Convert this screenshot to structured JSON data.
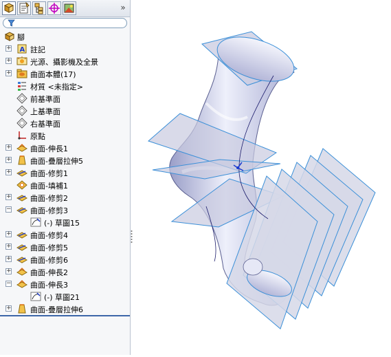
{
  "tabs": [
    {
      "name": "featuremanager-tab",
      "icon": "featuremanager-tree-icon"
    },
    {
      "name": "propertymanager-tab",
      "icon": "property-manager-icon"
    },
    {
      "name": "configurationmanager-tab",
      "icon": "configuration-manager-icon"
    },
    {
      "name": "dimxpert-tab",
      "icon": "dimxpert-crosshair-icon"
    },
    {
      "name": "display-manager-tab",
      "icon": "display-manager-icon"
    }
  ],
  "more_glyph": "»",
  "tree": {
    "root": {
      "label": "腳",
      "icon": "part-icon"
    },
    "items": [
      {
        "label": "註記",
        "icon": "annotations-icon",
        "expander": "+"
      },
      {
        "label": "光源、攝影機及全景",
        "icon": "lights-cameras-icon",
        "expander": "+"
      },
      {
        "label": "曲面本體(17)",
        "icon": "surface-bodies-folder-icon",
        "expander": "+"
      },
      {
        "label": "材質 <未指定>",
        "icon": "material-icon",
        "expander": ""
      },
      {
        "label": "前基準面",
        "icon": "plane-icon",
        "expander": ""
      },
      {
        "label": "上基準面",
        "icon": "plane-icon",
        "expander": ""
      },
      {
        "label": "右基準面",
        "icon": "plane-icon",
        "expander": ""
      },
      {
        "label": "原點",
        "icon": "origin-icon",
        "expander": ""
      },
      {
        "label": "曲面-伸長1",
        "icon": "surface-extrude-icon",
        "expander": "+"
      },
      {
        "label": "曲面-疊層拉伸5",
        "icon": "surface-loft-icon",
        "expander": "+"
      },
      {
        "label": "曲面-修剪1",
        "icon": "surface-trim-icon",
        "expander": "+"
      },
      {
        "label": "曲面-填補1",
        "icon": "surface-fill-icon",
        "expander": ""
      },
      {
        "label": "曲面-修剪2",
        "icon": "surface-trim-icon",
        "expander": "+"
      },
      {
        "label": "曲面-修剪3",
        "icon": "surface-trim-icon",
        "expander": "−"
      },
      {
        "label": "(-) 草圖15",
        "icon": "sketch-icon",
        "expander": "",
        "child": true
      },
      {
        "label": "曲面-修剪4",
        "icon": "surface-trim-icon",
        "expander": "+"
      },
      {
        "label": "曲面-修剪5",
        "icon": "surface-trim-icon",
        "expander": "+"
      },
      {
        "label": "曲面-修剪6",
        "icon": "surface-trim-icon",
        "expander": "+"
      },
      {
        "label": "曲面-伸長2",
        "icon": "surface-extrude-icon",
        "expander": "+"
      },
      {
        "label": "曲面-伸長3",
        "icon": "surface-extrude-icon",
        "expander": "−"
      },
      {
        "label": "(-) 草圖21",
        "icon": "sketch-icon",
        "expander": "",
        "child": true
      },
      {
        "label": "曲面-疊層拉伸6",
        "icon": "surface-loft-icon",
        "expander": "+"
      }
    ]
  },
  "colors": {
    "plane_edge": "#3a8fd8",
    "plane_fill": "#c9cbe0",
    "body": "#d8dbee",
    "tree_line": "#3c66a8"
  }
}
